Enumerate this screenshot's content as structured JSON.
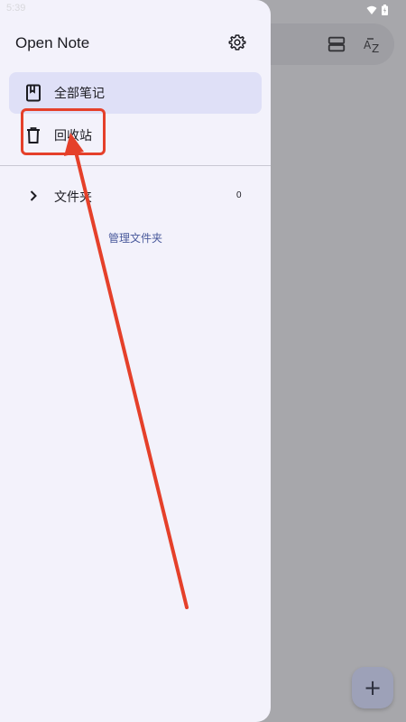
{
  "status_bar": {
    "time": "5:39",
    "icons": [
      "wifi-icon",
      "battery-icon"
    ]
  },
  "background_app": {
    "toolbar_icons": [
      "view-layout-icon",
      "sort-az-icon"
    ],
    "fab_label": "+",
    "fab_icon": "add-icon"
  },
  "drawer": {
    "title": "Open Note",
    "settings_icon": "gear-icon",
    "nav_items": [
      {
        "label": "全部笔记",
        "icon": "book-icon",
        "active": true
      },
      {
        "label": "回收站",
        "icon": "trash-icon",
        "active": false
      }
    ],
    "folders": {
      "label": "文件夹",
      "count": "0",
      "icon": "chevron-right-icon"
    },
    "manage_folders_label": "管理文件夹"
  },
  "annotation": {
    "color": "#e5402a",
    "target": "回收站"
  },
  "colors": {
    "drawer_bg": "#f3f2fb",
    "active_item_bg": "#dfe0f7",
    "link": "#4a5a9c",
    "scrim": "#a7a7ab"
  }
}
